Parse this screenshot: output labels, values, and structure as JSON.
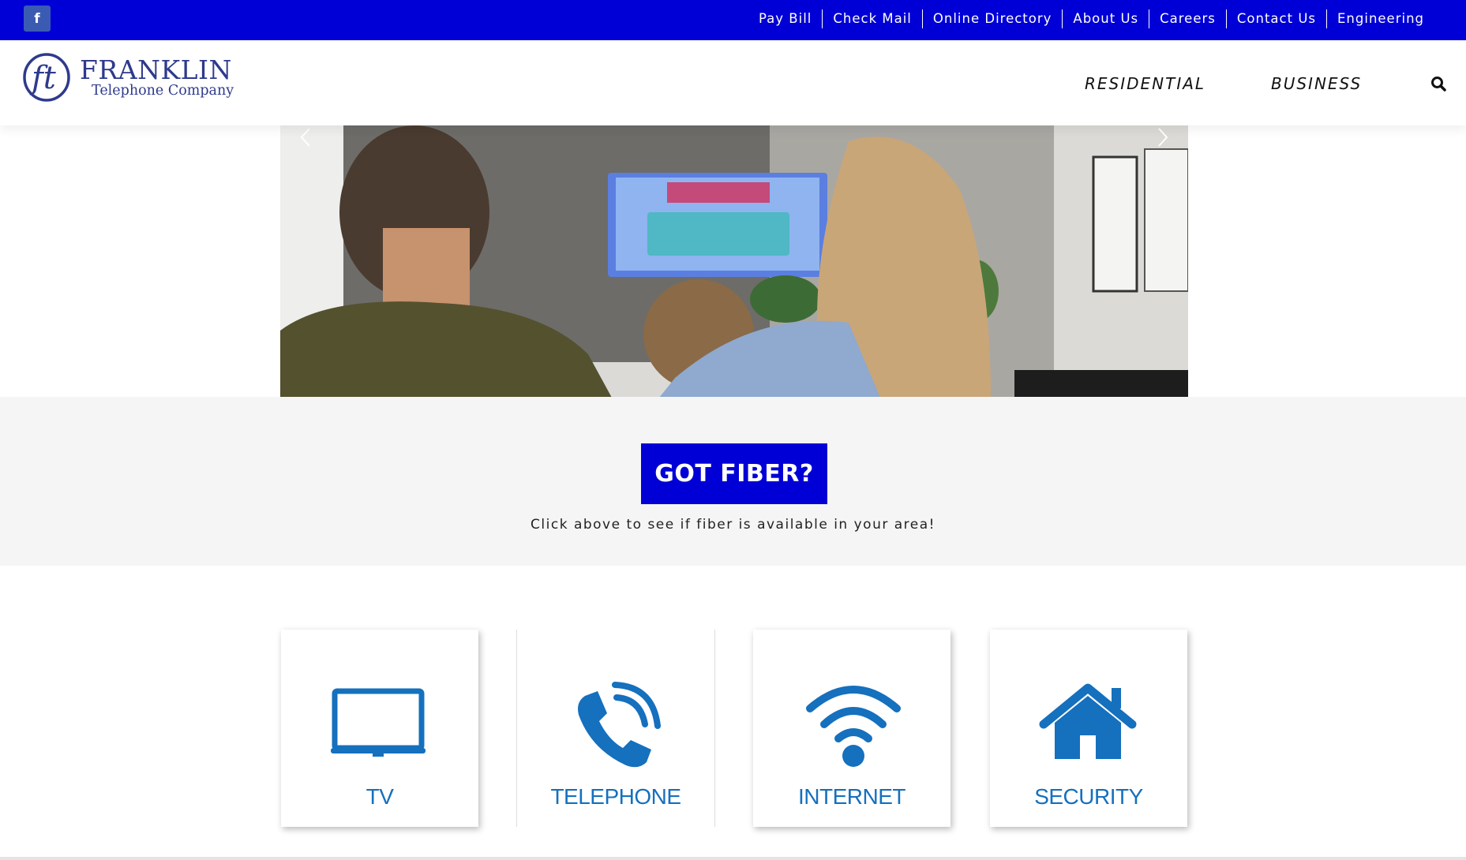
{
  "topbar": {
    "social_icon": "facebook-icon",
    "links": [
      "Pay Bill",
      "Check Mail",
      "Online Directory",
      "About Us",
      "Careers",
      "Contact Us",
      "Engineering"
    ]
  },
  "header": {
    "logo": {
      "monogram": "ft",
      "name": "FRANKLIN",
      "subtitle": "Telephone Company"
    },
    "nav": [
      "RESIDENTIAL",
      "BUSINESS"
    ],
    "search_icon": "search-icon"
  },
  "hero": {
    "prev_icon": "chevron-left-icon",
    "next_icon": "chevron-right-icon"
  },
  "fiber": {
    "button_label": "GOT FIBER?",
    "caption": "Click above to see if fiber is available in your area!"
  },
  "services": [
    {
      "label": "TV",
      "icon": "tv-icon"
    },
    {
      "label": "TELEPHONE",
      "icon": "phone-icon"
    },
    {
      "label": "INTERNET",
      "icon": "wifi-icon"
    },
    {
      "label": "SECURITY",
      "icon": "house-icon"
    }
  ],
  "colors": {
    "brand_blue": "#0000d6",
    "logo_blue": "#2e3a8c",
    "service_blue": "#1570be",
    "band_gray": "#f5f5f5"
  }
}
